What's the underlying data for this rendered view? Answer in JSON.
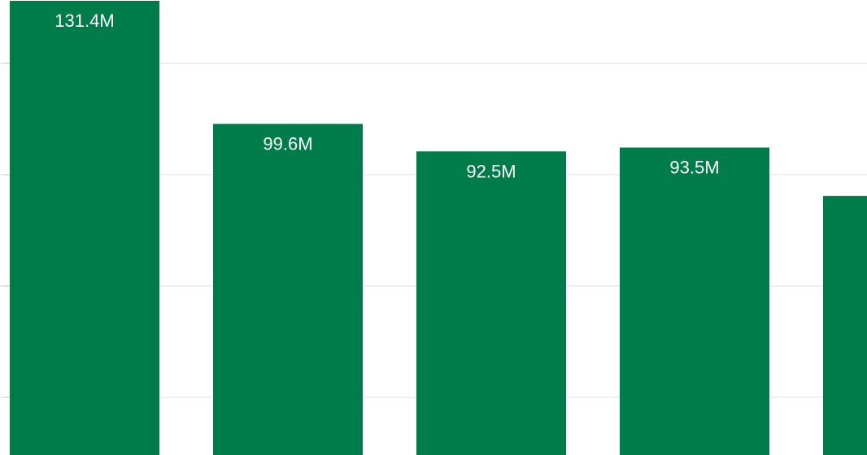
{
  "chart_data": {
    "type": "bar",
    "values": [
      131.4,
      99.6,
      92.5,
      93.5,
      81.0
    ],
    "data_labels": [
      "131.4M",
      "99.6M",
      "92.5M",
      "93.5M",
      ""
    ],
    "ylim": [
      0,
      131.4
    ],
    "grid": true,
    "legend": "none"
  },
  "colors": {
    "bar": "#007c4b",
    "grid": "#e5e5e5",
    "axis_tick": "#cfcfcf",
    "label": "#ffffff",
    "background": "#ffffff"
  }
}
